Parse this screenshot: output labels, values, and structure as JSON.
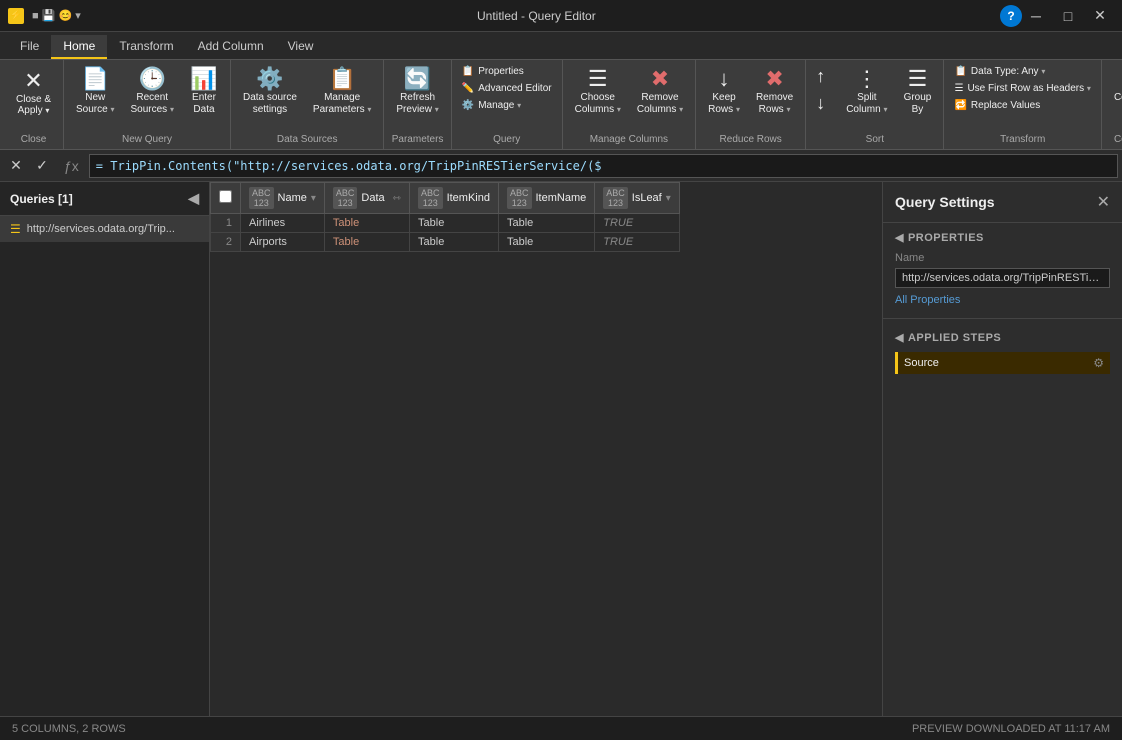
{
  "window": {
    "title": "Untitled - Query Editor",
    "icon": "⚡",
    "controls": [
      "minimize",
      "maximize",
      "close"
    ]
  },
  "ribbon_tabs": [
    {
      "id": "file",
      "label": "File",
      "active": false
    },
    {
      "id": "home",
      "label": "Home",
      "active": true
    },
    {
      "id": "transform",
      "label": "Transform",
      "active": false
    },
    {
      "id": "add_column",
      "label": "Add Column",
      "active": false
    },
    {
      "id": "view",
      "label": "View",
      "active": false
    }
  ],
  "ribbon": {
    "groups": [
      {
        "label": "Close",
        "items": [
          {
            "type": "close_apply",
            "label1": "Close &",
            "label2": "Apply",
            "sublabel": "▾",
            "icon": "✕"
          }
        ]
      },
      {
        "label": "New Query",
        "items": [
          {
            "type": "btn",
            "label": "New\nSource",
            "icon": "📄",
            "dropdown": true
          },
          {
            "type": "btn",
            "label": "Recent\nSources",
            "icon": "🕒",
            "dropdown": true
          },
          {
            "type": "btn",
            "label": "Enter\nData",
            "icon": "📊"
          }
        ]
      },
      {
        "label": "Data Sources",
        "items": [
          {
            "type": "btn",
            "label": "Data source\nsettings",
            "icon": "⚙️"
          },
          {
            "type": "btn",
            "label": "Manage\nParameters",
            "icon": "📋",
            "dropdown": true
          }
        ]
      },
      {
        "label": "Parameters",
        "items": [
          {
            "type": "btn",
            "label": "Refresh\nPreview",
            "icon": "🔄",
            "dropdown": true
          }
        ]
      },
      {
        "label": "Query",
        "items": [
          {
            "type": "col",
            "items": [
              {
                "label": "Properties",
                "icon": "📋"
              },
              {
                "label": "Advanced Editor",
                "icon": "✏️"
              },
              {
                "label": "Manage ▾",
                "icon": "⚙️"
              }
            ]
          }
        ]
      },
      {
        "label": "Manage Columns",
        "items": [
          {
            "type": "btn",
            "label": "Choose\nColumns",
            "icon": "☰",
            "dropdown": true
          },
          {
            "type": "btn",
            "label": "Remove\nColumns",
            "icon": "✖",
            "dropdown": true
          }
        ]
      },
      {
        "label": "Reduce Rows",
        "items": [
          {
            "type": "btn",
            "label": "Keep\nRows",
            "icon": "↓",
            "dropdown": true
          },
          {
            "type": "btn",
            "label": "Remove\nRows",
            "icon": "✖",
            "dropdown": true
          }
        ]
      },
      {
        "label": "Sort",
        "items": [
          {
            "type": "col2",
            "items": [
              {
                "label": "↑",
                "icon": ""
              },
              {
                "label": "↓",
                "icon": ""
              }
            ]
          },
          {
            "type": "btn",
            "label": "Split\nColumn",
            "icon": "⋮",
            "dropdown": true
          },
          {
            "type": "btn",
            "label": "Group\nBy",
            "icon": "☰"
          }
        ]
      },
      {
        "label": "Transform",
        "items": [
          {
            "type": "col3",
            "items": [
              {
                "label": "Data Type: Any ▾"
              },
              {
                "label": "Use First Row as Headers ▾"
              },
              {
                "label": "Replace Values"
              }
            ]
          }
        ]
      },
      {
        "label": "Combine",
        "items": [
          {
            "type": "btn",
            "label": "Combine",
            "icon": "⊞"
          }
        ]
      }
    ]
  },
  "sidebar": {
    "header": "Queries [1]",
    "items": [
      {
        "label": "http://services.odata.org/Trip...",
        "icon": "☰"
      }
    ]
  },
  "formula_bar": {
    "formula": "= TripPin.Contents(\"http://services.odata.org/TripPinRESTierService/($"
  },
  "table": {
    "columns": [
      {
        "name": "Name",
        "type": "ABC\n123",
        "has_dropdown": true,
        "has_expand": false
      },
      {
        "name": "Data",
        "type": "ABC\n123",
        "has_dropdown": false,
        "has_expand": true
      },
      {
        "name": "ItemKind",
        "type": "ABC\n123",
        "has_dropdown": false,
        "has_expand": false
      },
      {
        "name": "ItemName",
        "type": "ABC\n123",
        "has_dropdown": false,
        "has_expand": false
      },
      {
        "name": "IsLeaf",
        "type": "ABC\n123",
        "has_dropdown": true,
        "has_expand": false
      }
    ],
    "rows": [
      {
        "num": 1,
        "cells": [
          "Airlines",
          "Table",
          "Table",
          "Table",
          "TRUE"
        ]
      },
      {
        "num": 2,
        "cells": [
          "Airports",
          "Table",
          "Table",
          "Table",
          "TRUE"
        ]
      }
    ]
  },
  "query_settings": {
    "title": "Query Settings",
    "properties_label": "PROPERTIES",
    "name_label": "Name",
    "name_value": "http://services.odata.org/TripPinRESTierS",
    "all_properties_link": "All Properties",
    "applied_steps_label": "APPLIED STEPS",
    "steps": [
      {
        "label": "Source",
        "has_gear": true
      }
    ]
  },
  "status_bar": {
    "left": "5 COLUMNS, 2 ROWS",
    "right": "PREVIEW DOWNLOADED AT 11:17 AM"
  }
}
